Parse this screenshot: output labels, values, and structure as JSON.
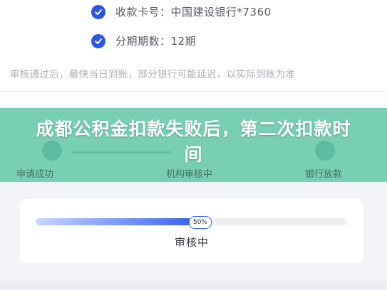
{
  "details": {
    "rows": [
      {
        "text": "收款卡号：中国建设银行*7360",
        "icon": "check-circle-icon"
      },
      {
        "text": "分期期数：12期",
        "icon": "check-circle-icon"
      }
    ],
    "notice": "审核通过后，最快当日到账，部分银行可能延迟，以实际到账为准"
  },
  "banner": {
    "title": "成都公积金扣款失败后，第二次扣款时间",
    "color": "#68c9a8"
  },
  "steps": [
    {
      "label": "申请成功"
    },
    {
      "label": "机构审核中"
    },
    {
      "label": "银行放款"
    }
  ],
  "progress": {
    "percent": 50,
    "badge": "50%",
    "status": "审核中",
    "accent": "#3d64ef"
  }
}
